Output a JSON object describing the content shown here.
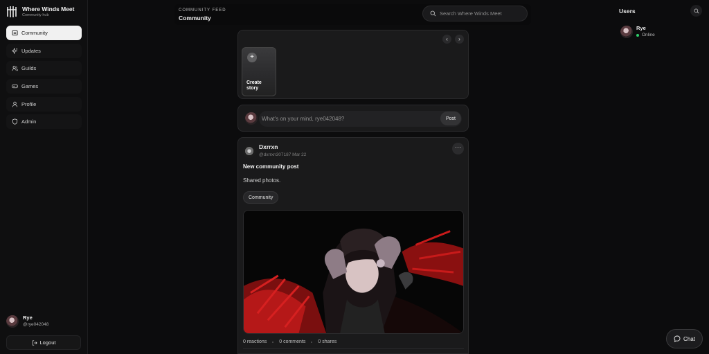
{
  "brand": {
    "title": "Where Winds Meet",
    "subtitle": "Community hub"
  },
  "sidebar": {
    "items": [
      {
        "label": "Community",
        "icon": "feed-icon",
        "active": true
      },
      {
        "label": "Updates",
        "icon": "sparkle-icon"
      },
      {
        "label": "Guilds",
        "icon": "users-icon"
      },
      {
        "label": "Games",
        "icon": "gamepad-icon"
      },
      {
        "label": "Profile",
        "icon": "user-icon"
      },
      {
        "label": "Admin",
        "icon": "shield-icon"
      }
    ],
    "current_user": {
      "name": "Rye",
      "handle": "@rye042048"
    },
    "logout_label": "Logout"
  },
  "header": {
    "kicker": "COMMUNITY FEED",
    "title": "Community",
    "search_placeholder": "Search Where Winds Meet"
  },
  "stories": {
    "create_label": "Create story"
  },
  "composer": {
    "placeholder": "What's on your mind, rye042048?",
    "post_label": "Post"
  },
  "post": {
    "author": "Dxrrxn",
    "meta": "@dxrrxn307187 Mar 22",
    "title": "New community post",
    "body": "Shared photos.",
    "tag": "Community",
    "stats": {
      "reactions": "0 reactions",
      "comments": "0 comments",
      "shares": "0 shares"
    }
  },
  "users_panel": {
    "title": "Users",
    "users": [
      {
        "name": "Rye",
        "status": "Online"
      }
    ]
  },
  "chat_label": "Chat",
  "colors": {
    "accent": "#f1f1f1",
    "online": "#2fcf6a",
    "background": "#0c0c0d"
  }
}
